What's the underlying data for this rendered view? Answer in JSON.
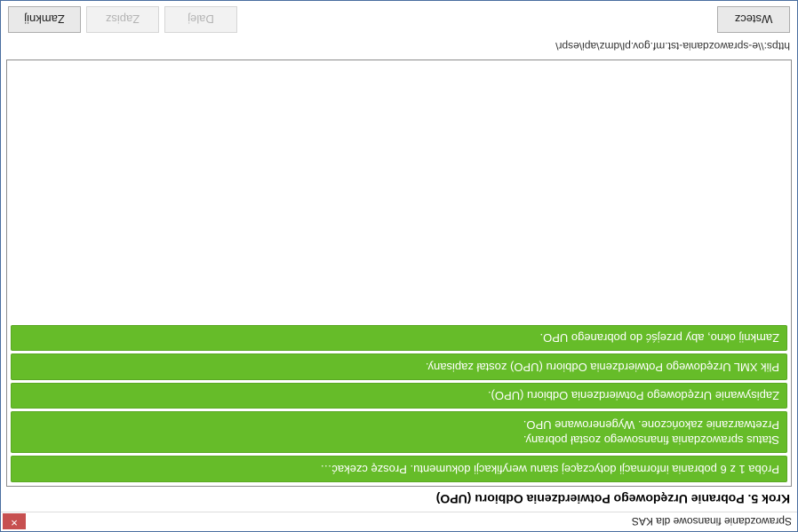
{
  "window": {
    "title": "Sprawozdanie finansowe dla KAS"
  },
  "step": {
    "heading": "Krok 5. Pobranie Urzędowego Potwierdzenia Odbioru (UPO)"
  },
  "log": {
    "items": [
      "Próba 1 z 6 pobrania informacji dotyczącej stanu weryfikacji dokumentu. Proszę czekać…",
      "Status sprawozdania finansowego został pobrany.\nPrzetwarzanie zakończone. Wygenerowane UPO.",
      "Zapisywanie Urzędowego Potwierdzenia Odbioru (UPO).",
      "Plik XML Urzędowego Potwierdzenia Odbioru (UPO) został zapisany.",
      "Zamknij okno, aby przejść do pobranego UPO."
    ]
  },
  "url": "https:\\\\e-sprawozdania-tst.mf.gov.pl\\dmz\\api\\espr\\",
  "buttons": {
    "back": "Wstecz",
    "next": "Dalej",
    "save": "Zapisz",
    "close": "Zamknij"
  },
  "icons": {
    "close": "✕"
  }
}
